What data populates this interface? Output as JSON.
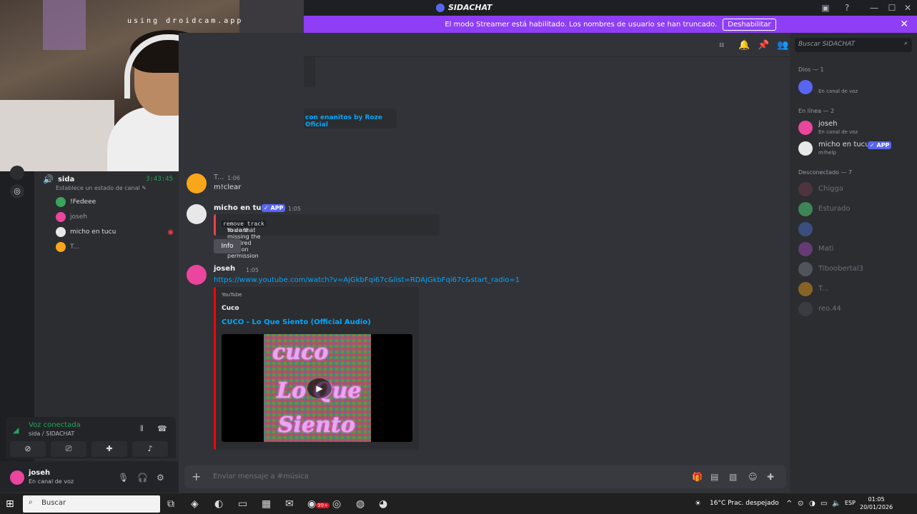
{
  "window": {
    "title": "SIDACHAT",
    "controls": [
      "minimize",
      "maximize",
      "close"
    ]
  },
  "banner": {
    "text": "El modo Streamer está habilitado. Los nombres de usuario se han truncado.",
    "button": "Deshabilitar"
  },
  "webcam": {
    "overlay": "using droidcam.app"
  },
  "voice_channel": {
    "name": "sida",
    "timer": "3:43:45",
    "status": "Establece un estado de canal",
    "users": [
      {
        "name": "!Fedeee",
        "color": "#3ba55c"
      },
      {
        "name": "joseh",
        "color": "#eb459e"
      },
      {
        "name": "micho en tucu",
        "color": "#f2f3f5"
      },
      {
        "name": "T...",
        "color": "#faa61a"
      }
    ]
  },
  "voice_panel": {
    "connected": "Voz conectada",
    "location": "sida / SIDACHAT"
  },
  "user_panel": {
    "name": "joseh",
    "status": "En canal de voz"
  },
  "prev_embed": {
    "text": "con enanitos by Roze Oficial"
  },
  "messages": [
    {
      "author": "T...",
      "time": "1:06",
      "text": "m!clear",
      "color": "#faa61a"
    },
    {
      "author": "micho en tucu",
      "app": "APP",
      "time": "1:05",
      "error_prefix": "You are missing the required session permission",
      "error_code": "remove track",
      "error_suffix": "to do that",
      "button": "Info"
    },
    {
      "author": "joseh",
      "time": "1:05",
      "link": "https://www.youtube.com/watch?v=AjGkbFqi67c&list=RDAjGkbFqi67c&start_radio=1",
      "embed": {
        "provider": "YouTube",
        "author": "Cuco",
        "title": "CUCO - Lo Que Siento (Official Audio)",
        "thumb_words": [
          "cuco",
          "Lo Que",
          "Siento"
        ]
      }
    }
  ],
  "composer": {
    "placeholder": "Enviar mensaje a #música"
  },
  "members": {
    "search_placeholder": "Buscar SIDACHAT",
    "groups": [
      {
        "label": "Dios — 1",
        "items": [
          {
            "name": "",
            "status": "En canal de voz",
            "color": "#5865f2"
          }
        ]
      },
      {
        "label": "En línea — 2",
        "items": [
          {
            "name": "joseh",
            "status": "En canal de voz",
            "color": "#eb459e"
          },
          {
            "name": "micho en tucu",
            "app": "APP",
            "status": "m!help",
            "color": "#dbdee1"
          }
        ]
      },
      {
        "label": "Desconectado — 7",
        "items": [
          {
            "name": "Chigga",
            "color": "#7a3f4c"
          },
          {
            "name": "Esturado",
            "color": "#57f287"
          },
          {
            "name": "",
            "color": "#4e7ae0"
          },
          {
            "name": "Mati",
            "color": "#b04ec9"
          },
          {
            "name": "Tiboobertal3",
            "color": "#80848e"
          },
          {
            "name": "T...",
            "color": "#faa61a"
          },
          {
            "name": "reo.44",
            "color": "#4e5058"
          }
        ]
      }
    ]
  },
  "taskbar": {
    "search": "Buscar",
    "badge": "99+",
    "weather": "16°C  Prac. despejado",
    "lang": "ESP",
    "time": "01:05",
    "date": "20/01/2026"
  }
}
